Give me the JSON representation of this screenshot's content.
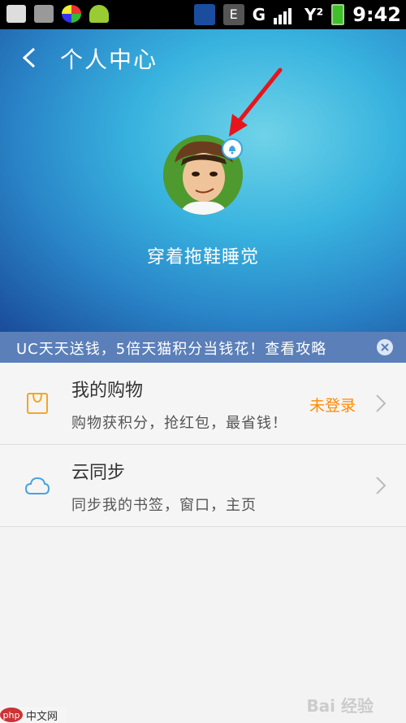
{
  "status_bar": {
    "carrier_badge": "E",
    "signal_text": "G",
    "signal_text2": "Y²",
    "time": "9:42"
  },
  "header": {
    "title": "个人中心",
    "nickname": "穿着拖鞋睡觉"
  },
  "banner": {
    "text": "UC天天送钱，5倍天猫积分当钱花！查看攻略"
  },
  "list": {
    "items": [
      {
        "title": "我的购物",
        "subtitle": "购物获积分，抢红包，最省钱！",
        "status": "未登录",
        "icon": "shopping-bag-icon"
      },
      {
        "title": "云同步",
        "subtitle": "同步我的书签，窗口，主页",
        "status": "",
        "icon": "cloud-icon"
      }
    ]
  },
  "footer": {
    "watermark": "Bai 经验",
    "php_logo_badge": "php",
    "php_logo_text": "中文网"
  },
  "colors": {
    "accent_orange": "#ff8a00",
    "banner_blue": "#5b7fb8",
    "header_blue": "#2a86c8"
  }
}
